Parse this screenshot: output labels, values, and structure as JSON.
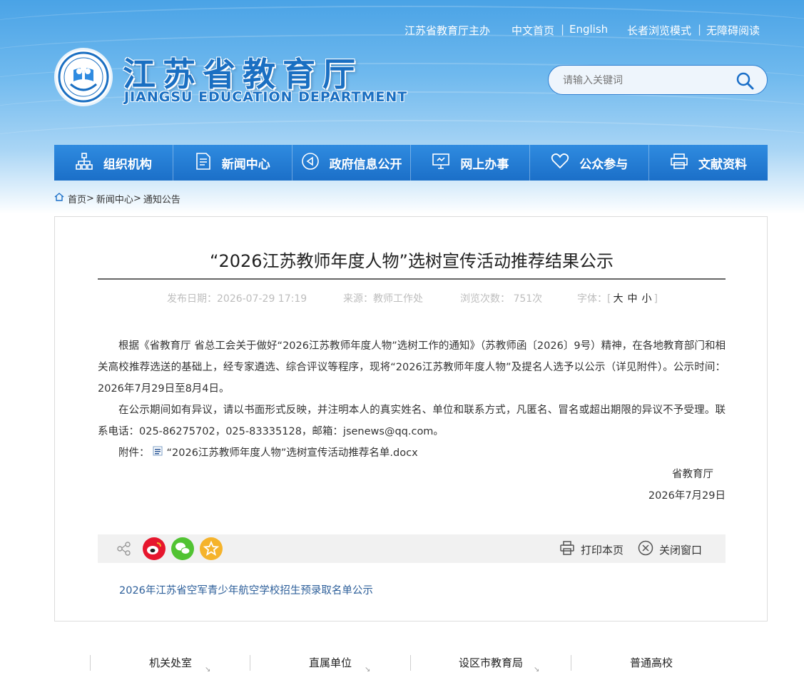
{
  "header": {
    "top_links": {
      "sponsor": "江苏省教育厅主办",
      "home_cn": "中文首页",
      "separator": "|",
      "english": "English",
      "elder_mode": "长者浏览模式",
      "accessible": "无障碍阅读"
    },
    "logo": {
      "title": "江苏省教育厅",
      "subtitle": "JIANGSU EDUCATION DEPARTMENT"
    },
    "search": {
      "placeholder": "请输入关键词"
    }
  },
  "nav": [
    {
      "label": "组织机构",
      "icon": "org-chart-icon"
    },
    {
      "label": "新闻中心",
      "icon": "document-icon"
    },
    {
      "label": "政府信息公开",
      "icon": "speaker-icon"
    },
    {
      "label": "网上办事",
      "icon": "monitor-icon"
    },
    {
      "label": "公众参与",
      "icon": "heart-icon"
    },
    {
      "label": "文献资料",
      "icon": "printer-icon"
    }
  ],
  "breadcrumb": {
    "home": "首页",
    "sep": ">",
    "news": "新闻中心",
    "notices": "通知公告"
  },
  "article": {
    "title": "“2026江苏教师年度人物”选树宣传活动推荐结果公示",
    "meta": {
      "published": "发布日期：2026-07-29 17:19",
      "source": "来源：教师工作处",
      "views": "浏览次数： 751次",
      "font_label": "字体：",
      "bracket_open": "[",
      "bracket_close": "]",
      "size_large": "大",
      "size_medium": "中",
      "size_small": "小"
    },
    "para1": "根据《省教育厅 省总工会关于做好“2026江苏教师年度人物”选树工作的通知》（苏教师函〔2026〕9号）精神，在各地教育部门和相关高校推荐选送的基础上，经专家遴选、综合评议等程序，现将“2026江苏教师年度人物”及提名人选予以公示（详见附件）。公示时间：2026年7月29日至8月4日。",
    "para2": "在公示期间如有异议，请以书面形式反映，并注明本人的真实姓名、单位和联系方式，凡匿名、冒名或超出期限的异议不予受理。联系电话：025-86275702，025-83335128，邮箱：jsenews@qq.com。",
    "attachment_label": "附件：",
    "attachment_name": "“2026江苏教师年度人物”选树宣传活动推荐名单.docx",
    "signature": "省教育厅",
    "date": "2026年7月29日"
  },
  "share": {
    "print": "打印本页",
    "close": "关闭窗口"
  },
  "related": {
    "link": "2026年江苏省空军青少年航空学校招生预录取名单公示"
  },
  "footer_nav": [
    {
      "label": "机关处室"
    },
    {
      "label": "直属单位"
    },
    {
      "label": "设区市教育局"
    },
    {
      "label": "普通高校"
    }
  ],
  "colors": {
    "brand_blue": "#1b6fc8",
    "weibo_red": "#e6162d",
    "wechat_green": "#51c332",
    "favorite_orange": "#f5b32b",
    "link_blue": "#2d5f9a"
  }
}
